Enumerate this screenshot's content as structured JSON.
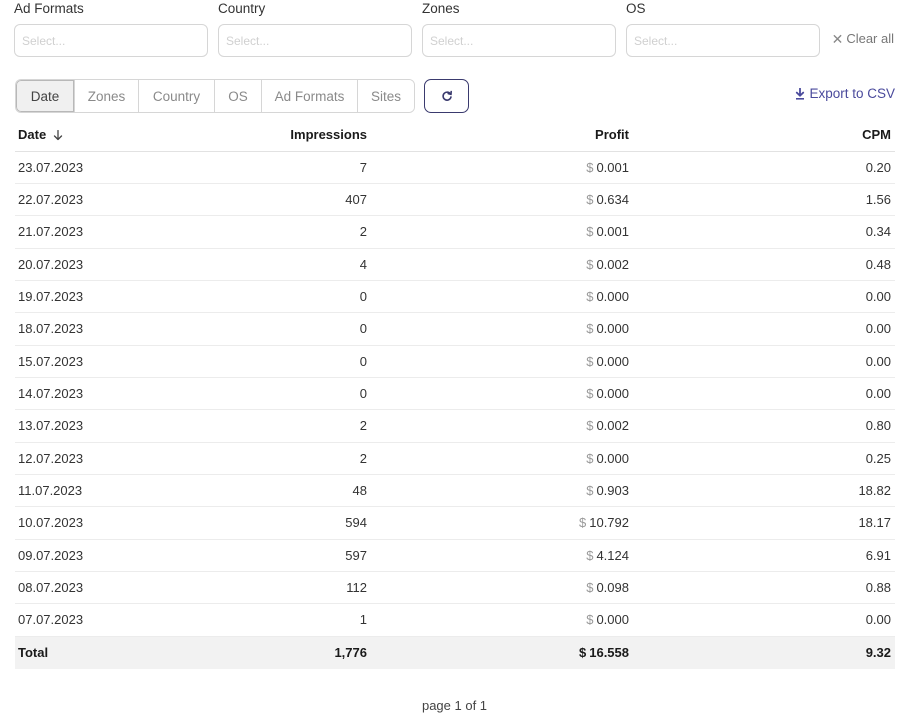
{
  "filters": [
    {
      "label": "Ad Formats",
      "placeholder": "Select..."
    },
    {
      "label": "Country",
      "placeholder": "Select..."
    },
    {
      "label": "Zones",
      "placeholder": "Select..."
    },
    {
      "label": "OS",
      "placeholder": "Select..."
    }
  ],
  "clear_all": "Clear all",
  "tabs": [
    "Date",
    "Zones",
    "Country",
    "OS",
    "Ad Formats",
    "Sites"
  ],
  "active_tab": "Date",
  "export_label": "Export to CSV",
  "table": {
    "columns": {
      "date": "Date",
      "impressions": "Impressions",
      "profit": "Profit",
      "cpm": "CPM"
    },
    "currency": "$",
    "rows": [
      {
        "date": "23.07.2023",
        "impressions": "7",
        "profit": "0.001",
        "cpm": "0.20"
      },
      {
        "date": "22.07.2023",
        "impressions": "407",
        "profit": "0.634",
        "cpm": "1.56"
      },
      {
        "date": "21.07.2023",
        "impressions": "2",
        "profit": "0.001",
        "cpm": "0.34"
      },
      {
        "date": "20.07.2023",
        "impressions": "4",
        "profit": "0.002",
        "cpm": "0.48"
      },
      {
        "date": "19.07.2023",
        "impressions": "0",
        "profit": "0.000",
        "cpm": "0.00"
      },
      {
        "date": "18.07.2023",
        "impressions": "0",
        "profit": "0.000",
        "cpm": "0.00"
      },
      {
        "date": "15.07.2023",
        "impressions": "0",
        "profit": "0.000",
        "cpm": "0.00"
      },
      {
        "date": "14.07.2023",
        "impressions": "0",
        "profit": "0.000",
        "cpm": "0.00"
      },
      {
        "date": "13.07.2023",
        "impressions": "2",
        "profit": "0.002",
        "cpm": "0.80"
      },
      {
        "date": "12.07.2023",
        "impressions": "2",
        "profit": "0.000",
        "cpm": "0.25"
      },
      {
        "date": "11.07.2023",
        "impressions": "48",
        "profit": "0.903",
        "cpm": "18.82"
      },
      {
        "date": "10.07.2023",
        "impressions": "594",
        "profit": "10.792",
        "cpm": "18.17"
      },
      {
        "date": "09.07.2023",
        "impressions": "597",
        "profit": "4.124",
        "cpm": "6.91"
      },
      {
        "date": "08.07.2023",
        "impressions": "112",
        "profit": "0.098",
        "cpm": "0.88"
      },
      {
        "date": "07.07.2023",
        "impressions": "1",
        "profit": "0.000",
        "cpm": "0.00"
      }
    ],
    "total": {
      "label": "Total",
      "impressions": "1,776",
      "profit": "16.558",
      "cpm": "9.32"
    }
  },
  "pagination": "page 1 of 1",
  "colors": {
    "accent": "#4a4a9c",
    "refresh_border": "#3a3a6e",
    "total_bg": "#f2f2f2"
  }
}
